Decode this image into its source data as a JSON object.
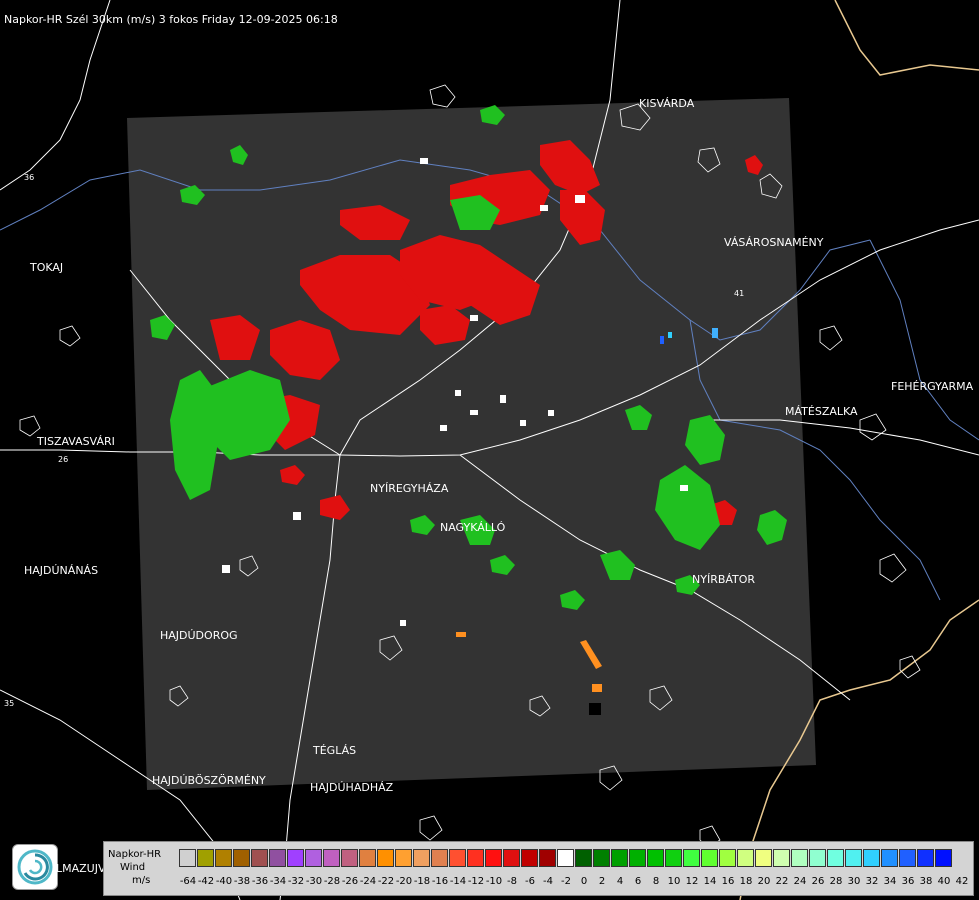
{
  "header": {
    "title": "Napkor-HR Szél 30km (m/s) 3 fokos Friday 12-09-2025 06:18"
  },
  "cities": [
    {
      "name": "KISVÁRDA",
      "id": "kisvarda"
    },
    {
      "name": "TOKAJ",
      "id": "tokaj"
    },
    {
      "name": "VÁSÁROSNAMÉNY",
      "id": "vasarosnameny"
    },
    {
      "name": "FEHÉRGYARMA",
      "id": "fehergyarmat"
    },
    {
      "name": "MÁTÉSZALKA",
      "id": "mateszalka"
    },
    {
      "name": "TISZAVASVÁRI",
      "id": "tiszavasvari"
    },
    {
      "name": "NYÍREGYHÁZA",
      "id": "nyiregyhaza"
    },
    {
      "name": "NAGYKÁLLÓ",
      "id": "nagykallo"
    },
    {
      "name": "HAJDÚNÁNÁS",
      "id": "hajdunanas"
    },
    {
      "name": "NYÍRBÁTOR",
      "id": "nyirbator"
    },
    {
      "name": "HAJDÚDOROG",
      "id": "hajdudorog"
    },
    {
      "name": "TÉGLÁS",
      "id": "teglas"
    },
    {
      "name": "HAJDÚBÖSZÖRMÉNY",
      "id": "hajduboszormeny"
    },
    {
      "name": "HAJDÚHADHÁZ",
      "id": "hajduhadhaz"
    }
  ],
  "road_labels": [
    "35",
    "26",
    "41",
    "36"
  ],
  "legend": {
    "title1": "Napkor-HR",
    "title2": "Wind",
    "unit": "m/s",
    "ticks": [
      "-64",
      "-42",
      "-40",
      "-38",
      "-36",
      "-34",
      "-32",
      "-30",
      "-28",
      "-26",
      "-24",
      "-22",
      "-20",
      "-18",
      "-16",
      "-14",
      "-12",
      "-10",
      "-8",
      "-6",
      "-4",
      "-2",
      "0",
      "2",
      "4",
      "6",
      "8",
      "10",
      "12",
      "14",
      "16",
      "18",
      "20",
      "22",
      "24",
      "26",
      "28",
      "30",
      "32",
      "34",
      "36",
      "38",
      "40",
      "42"
    ],
    "colors": [
      "#d0d0d0",
      "#a0a000",
      "#b08000",
      "#a06000",
      "#a05050",
      "#9050a0",
      "#a040ff",
      "#b060e0",
      "#c060c0",
      "#c06080",
      "#e08040",
      "#ff9000",
      "#ffa030",
      "#f0a060",
      "#e08050",
      "#ff5030",
      "#ff3020",
      "#ff1010",
      "#e01010",
      "#c00000",
      "#a00000",
      "#ffffff",
      "#006000",
      "#008000",
      "#00a000",
      "#00b000",
      "#00c000",
      "#10d010",
      "#40ff40",
      "#60ff30",
      "#a0ff40",
      "#d0ff80",
      "#f0ff80",
      "#d0ffb0",
      "#b0ffc0",
      "#90ffd0",
      "#70ffe0",
      "#50f0f0",
      "#30d0ff",
      "#2090ff",
      "#2060ff",
      "#1030ff",
      "#0010ff"
    ]
  },
  "logo": {
    "text": "LMAZUJVAR"
  }
}
